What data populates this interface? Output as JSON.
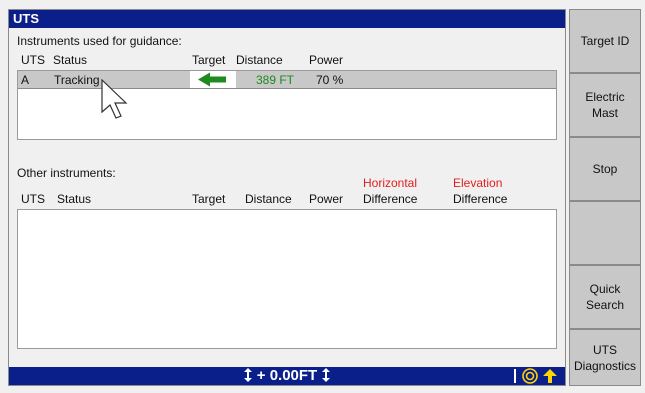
{
  "window": {
    "title": "UTS"
  },
  "guidance": {
    "label": "Instruments used for guidance:",
    "columns": {
      "uts": "UTS",
      "status": "Status",
      "target": "Target",
      "distance": "Distance",
      "power": "Power"
    },
    "row": {
      "uts": "A",
      "status": "Tracking",
      "distance": "389 FT",
      "power": "70 %"
    }
  },
  "other": {
    "label": "Other instruments:",
    "columns": {
      "uts": "UTS",
      "status": "Status",
      "target": "Target",
      "distance": "Distance",
      "power": "Power",
      "horizontal_top": "Horizontal",
      "horizontal_bottom": "Difference",
      "elevation_top": "Elevation",
      "elevation_bottom": "Difference"
    }
  },
  "statusbar": {
    "offset": "+ 0.00FT"
  },
  "sidebar": {
    "buttons": [
      {
        "line1": "Target ID",
        "line2": ""
      },
      {
        "line1": "Electric",
        "line2": "Mast"
      },
      {
        "line1": "Stop",
        "line2": ""
      },
      {
        "line1": "",
        "line2": ""
      },
      {
        "line1": "Quick",
        "line2": "Search"
      },
      {
        "line1": "UTS",
        "line2": "Diagnostics"
      }
    ]
  },
  "colors": {
    "titlebar": "#0a1f8a",
    "good": "#1f8a1f",
    "alert": "#e02020",
    "target_arrow": "#1f8a1f",
    "up_arrow": "#ffd400"
  },
  "icons": [
    "left-arrow-icon",
    "vertical-arrows-icon",
    "target-icon",
    "up-arrow-icon",
    "cursor-icon"
  ]
}
